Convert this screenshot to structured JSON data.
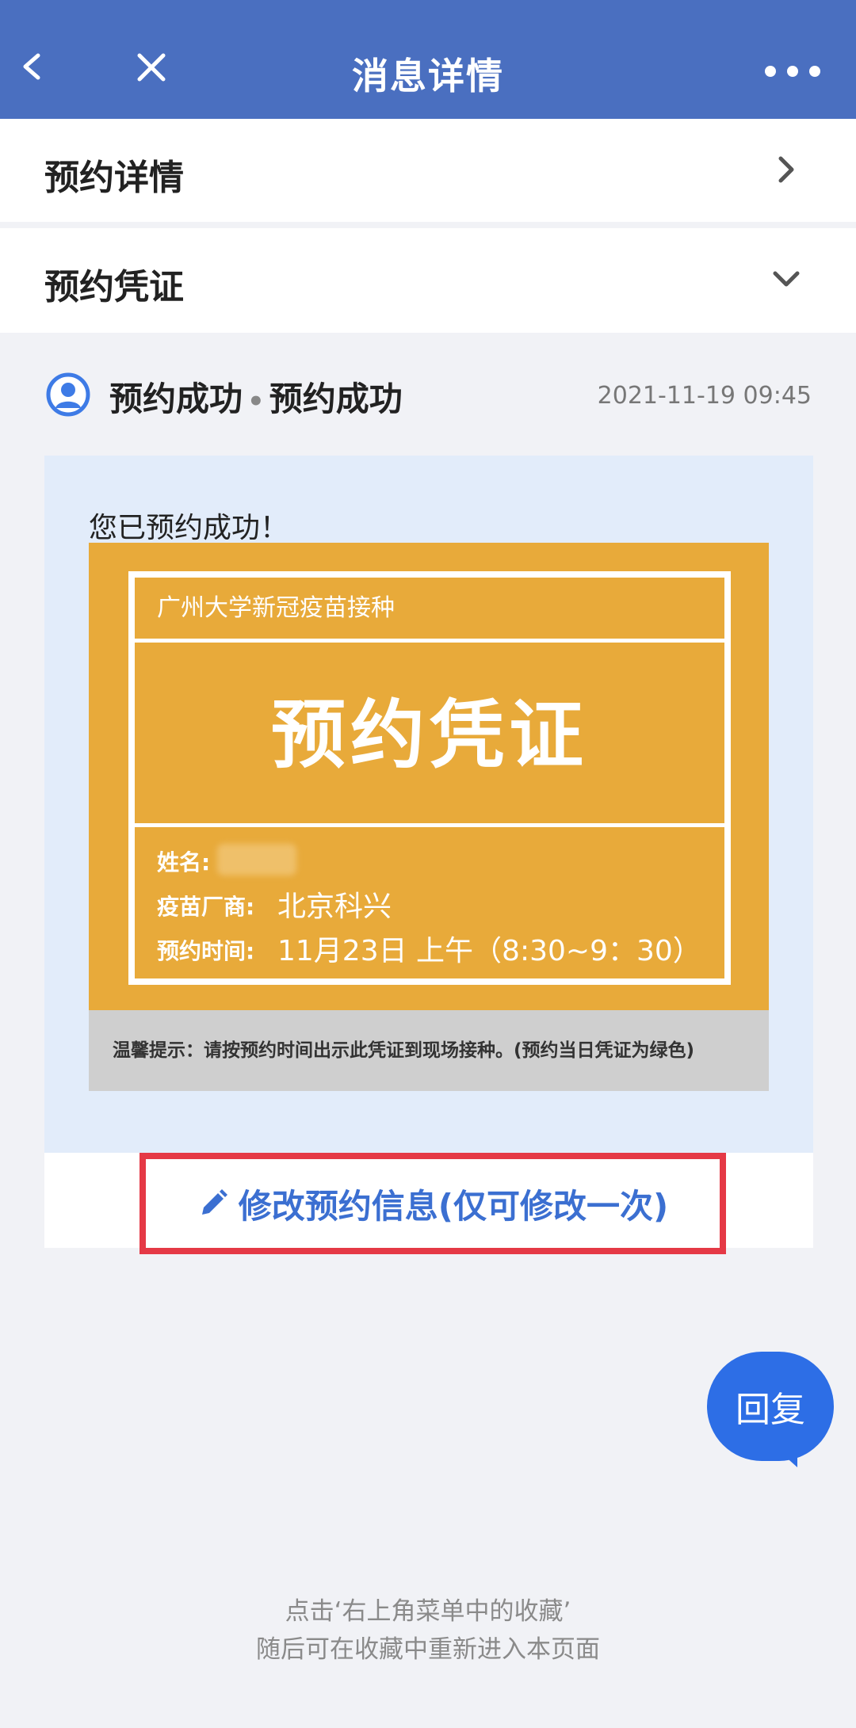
{
  "header": {
    "title": "消息详情"
  },
  "sections": {
    "details_label": "预约详情",
    "voucher_label": "预约凭证"
  },
  "message": {
    "sender": "预约成功",
    "separator": "•",
    "subject": "预约成功",
    "time": "2021-11-19 09:45",
    "intro": "您已预约成功！"
  },
  "voucher": {
    "org": "广州大学新冠疫苗接种",
    "title": "预约凭证",
    "name_label": "姓名:",
    "maker_label": "疫苗厂商:",
    "maker_value": "北京科兴",
    "time_label": "预约时间:",
    "time_value": "11月23日 上午（8:30~9：30）",
    "tip": "温馨提示：请按预约时间出示此凭证到现场接种。(预约当日凭证为绿色)"
  },
  "actions": {
    "edit_label": "修改预约信息(仅可修改一次)",
    "reply_label": "回复"
  },
  "footer": {
    "line1": "点击‘右上角菜单中的收藏’",
    "line2": "随后可在收藏中重新进入本页面"
  },
  "colors": {
    "header": "#4a6fc0",
    "voucher": "#e8aa3a",
    "edit_highlight": "#e53946",
    "link": "#3b6fd1",
    "reply": "#2d6ee6"
  },
  "icons": {
    "back": "back-icon",
    "close": "close-icon",
    "more": "more-icon",
    "chevron_right": "chevron-right-icon",
    "chevron_down": "chevron-down-icon",
    "avatar": "user-avatar-icon",
    "pencil": "pencil-icon"
  }
}
